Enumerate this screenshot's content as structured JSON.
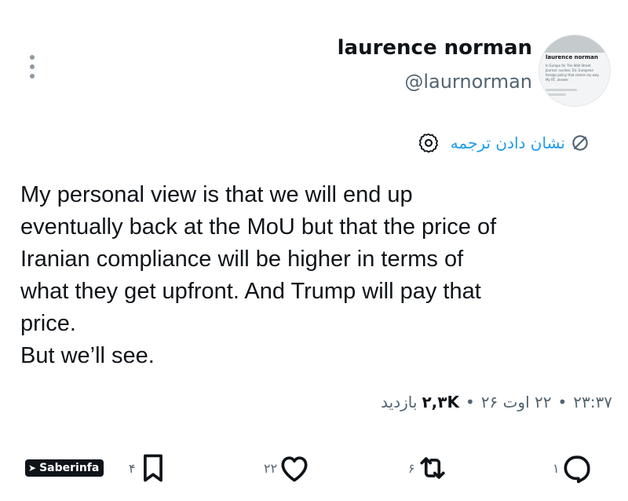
{
  "profile": {
    "name": "laurence norman",
    "handle": "@laurnorman",
    "avatar_preview": {
      "name": "laurence norman",
      "bio": "In Europe for The Wall Street Journal: nuclear, EU, European foreign policy that comes my way. My RT, answer"
    }
  },
  "translate": {
    "label": "نشان دادن ترجمه"
  },
  "tweet": {
    "lines": [
      "My personal view is that we will end up",
      "eventually back at the MoU but that the price of",
      "Iranian compliance will be higher in terms of",
      "what they get upfront. And Trump will pay that",
      "price.",
      "But we’ll see."
    ]
  },
  "meta": {
    "time": "۲۳:۳۷",
    "date": "۲۲ اوت ۲۶",
    "views_count": "۲,۳K",
    "views_label": "بازدید",
    "separator": "•"
  },
  "actions": {
    "reply_count": "۱",
    "retweet_count": "۶",
    "like_count": "۲۲",
    "bookmark_count": "۴"
  },
  "watermark": {
    "text": "Saberinfa"
  },
  "colors": {
    "accent": "#1d9bf0",
    "text": "#0f1419",
    "muted": "#536471"
  }
}
